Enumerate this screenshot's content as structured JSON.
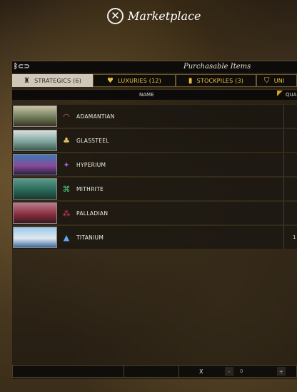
{
  "window": {
    "title": "Marketplace",
    "close_icon": "close-circle-icon"
  },
  "panel": {
    "header_title": "Purchasable Items",
    "emblem": "ᛒ⊂⊃"
  },
  "tabs": [
    {
      "label": "STRATEGICS (6)",
      "icon": "♜",
      "active": true
    },
    {
      "label": "LUXURIES (12)",
      "icon": "♥",
      "active": false
    },
    {
      "label": "STOCKPILES (3)",
      "icon": "▮",
      "active": false
    },
    {
      "label": "UNI",
      "icon": "⛉",
      "active": false
    }
  ],
  "columns": {
    "name": "NAME",
    "quantity": "QUA"
  },
  "resources": [
    {
      "name": "ADAMANTIAN",
      "icon": "◠",
      "icon_color": "#e06a50",
      "thumb": [
        "#c9c2a6",
        "#6e7d5a",
        "#3d3422"
      ],
      "qty": ""
    },
    {
      "name": "GLASSTEEL",
      "icon": "♣",
      "icon_color": "#e8c86a",
      "thumb": [
        "#d8e0e0",
        "#7fa6a0",
        "#3c5a4a"
      ],
      "qty": ""
    },
    {
      "name": "HYPERIUM",
      "icon": "✦",
      "icon_color": "#a060e0",
      "thumb": [
        "#3c7ab8",
        "#8a4a9a",
        "#2a2040"
      ],
      "qty": ""
    },
    {
      "name": "MITHRITE",
      "icon": "⌘",
      "icon_color": "#50d080",
      "thumb": [
        "#5a9a8a",
        "#2a6a5a",
        "#1a3a30"
      ],
      "qty": ""
    },
    {
      "name": "PALLADIAN",
      "icon": "⁂",
      "icon_color": "#e04060",
      "thumb": [
        "#b87a8a",
        "#8a3040",
        "#3a1a20"
      ],
      "qty": ""
    },
    {
      "name": "TITANIUM",
      "icon": "▲",
      "icon_color": "#60a8f0",
      "thumb": [
        "#9ac8e8",
        "#e0e8f0",
        "#3a6a9a"
      ],
      "qty": "1"
    }
  ],
  "footer": {
    "x_label": "X",
    "minus_label": "-",
    "plus_label": "+",
    "quantity_value": "0"
  }
}
